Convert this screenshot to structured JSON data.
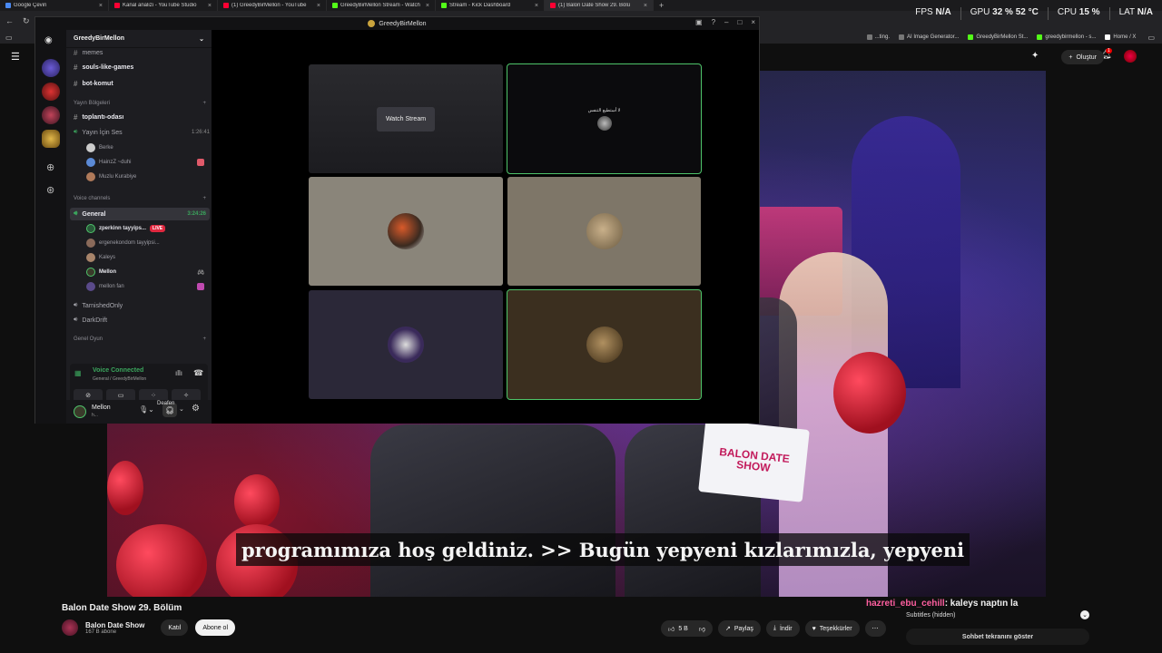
{
  "browser": {
    "tabs": [
      {
        "title": "Google Çeviri",
        "color": "#4a8af4"
      },
      {
        "title": "Kanal analizi - YouTube Studio",
        "color": "#ff0033"
      },
      {
        "title": "(1) GreedyBirMellon - YouTube",
        "color": "#ff0033"
      },
      {
        "title": "GreedyBirMellon Stream - Watch",
        "color": "#53fc18"
      },
      {
        "title": "Stream - Kick Dashboard",
        "color": "#53fc18"
      },
      {
        "title": "(1) Balon Date Show 29. Bölü",
        "color": "#ff0033"
      }
    ],
    "bookmarks": [
      {
        "label": "...ting.",
        "color": "#777"
      },
      {
        "label": "AI Image Generator...",
        "color": "#777"
      },
      {
        "label": "GreedyBirMellon St...",
        "color": "#53fc18"
      },
      {
        "label": "greedybirmellon - s...",
        "color": "#53fc18"
      },
      {
        "label": "Home / X",
        "color": "#ffffff"
      }
    ]
  },
  "perf": {
    "fps_label": "FPS",
    "fps_value": "N/A",
    "gpu_label": "GPU",
    "gpu_value": "32 %",
    "gpu_temp": "52 °C",
    "cpu_label": "CPU",
    "cpu_value": "15 %",
    "lat_label": "LAT",
    "lat_value": "N/A"
  },
  "youtube": {
    "create_label": "Oluştur",
    "notif_count": "1",
    "subtitle_text": "programımıza hoş geldiniz. >> Bugün yepyeni kızlarımızla, yepyeni",
    "sign_text": "BALON DATE SHOW",
    "video_title": "Balon Date Show 29. Bölüm",
    "channel_name": "Balon Date Show",
    "channel_subs": "167 B abone",
    "join_label": "Katıl",
    "subscribe_label": "Abone ol",
    "like_count": "5 B",
    "share_label": "Paylaş",
    "download_label": "İndir",
    "thanks_label": "Teşekkürler",
    "chat_user": "hazreti_ebu_cehill",
    "chat_message": ": kaleys naptın la",
    "subtitles_label": "Subtitles (hidden)",
    "show_chat_label": "Sohbet tekranını göster"
  },
  "discord": {
    "window_title": "GreedyBirMellon",
    "server_name": "GreedyBirMellon",
    "channels_top": [
      "memes",
      "souls-like-games",
      "bot-komut"
    ],
    "category_yayin": "Yayın Bölgeleri",
    "text_channel": "toplantı-odası",
    "voice_yayin": "Yayın İçin Ses",
    "voice_yayin_timer": "1:26:41",
    "yayin_users": [
      "Berke",
      "HainzZ ~duhi",
      "Muzlu Kurabiye"
    ],
    "category_voice": "Voice channels",
    "general_channel": "General",
    "general_timer": "3:24:26",
    "general_users": [
      {
        "name": "zperkinn tayyips...",
        "live": "LIVE"
      },
      {
        "name": "ergenekondom tayyipsi..."
      },
      {
        "name": "Kaleys"
      },
      {
        "name": "Mellon"
      },
      {
        "name": "mellon fan"
      }
    ],
    "other_channels": [
      "TarnishedOnly",
      "DarkDrift"
    ],
    "category_oyun": "Genel Oyun",
    "vc_status": "Voice Connected",
    "vc_location": "General / GreedyBirMellon",
    "tooltip": "Deafen",
    "me_name": "Mellon",
    "me_status": "h...",
    "watch_stream": "Watch Stream",
    "tile_text": "لا أستطيع التنفس"
  }
}
